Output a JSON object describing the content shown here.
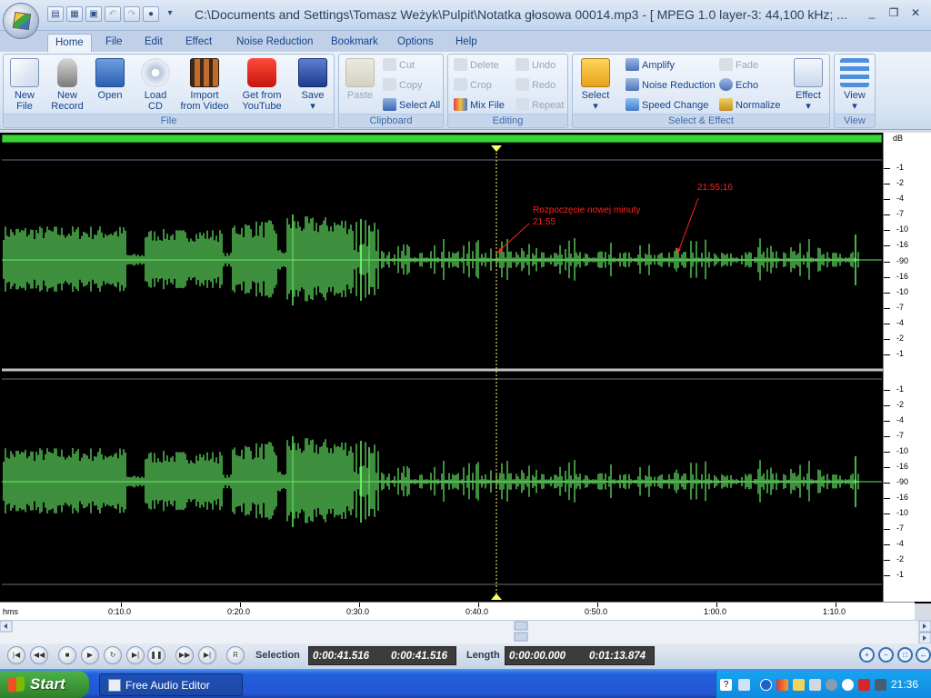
{
  "window": {
    "title": "C:\\Documents and Settings\\Tomasz Weżyk\\Pulpit\\Notatka głosowa 00014.mp3 - [ MPEG 1.0 layer-3: 44,100 kHz; ...",
    "controls": [
      "_",
      "❐",
      "✕"
    ]
  },
  "quick_access": [
    "new-file-icon",
    "open-icon",
    "save-icon",
    "undo-icon",
    "redo-icon",
    "record-icon"
  ],
  "tabs": [
    "Home",
    "File",
    "Edit",
    "Effect",
    "Noise Reduction",
    "Bookmark",
    "Options",
    "Help"
  ],
  "active_tab": "Home",
  "ribbon": {
    "file_group": {
      "label": "File",
      "buttons": [
        {
          "line1": "New",
          "line2": "File"
        },
        {
          "line1": "New",
          "line2": "Record"
        },
        {
          "line1": "Open",
          "line2": ""
        },
        {
          "line1": "Load",
          "line2": "CD"
        },
        {
          "line1": "Import",
          "line2": "from Video"
        },
        {
          "line1": "Get from",
          "line2": "YouTube"
        },
        {
          "line1": "Save",
          "line2": "▾"
        }
      ]
    },
    "clipboard_group": {
      "label": "Clipboard",
      "paste": "Paste",
      "cut": "Cut",
      "copy": "Copy",
      "select_all": "Select All"
    },
    "editing_group": {
      "label": "Editing",
      "delete": "Delete",
      "crop": "Crop",
      "mix_file": "Mix File",
      "undo": "Undo",
      "redo": "Redo",
      "repeat": "Repeat"
    },
    "select_effect_group": {
      "label": "Select & Effect",
      "select": "Select",
      "amplify": "Amplify",
      "noise_reduction": "Noise Reduction",
      "speed_change": "Speed Change",
      "fade": "Fade",
      "echo": "Echo",
      "normalize": "Normalize",
      "effect": "Effect"
    },
    "view_group": {
      "label": "View",
      "view": "View"
    }
  },
  "db_ruler": {
    "header": "dB",
    "ticks_top": [
      "-1",
      "-2",
      "-4",
      "-7",
      "-10",
      "-16",
      "-90",
      "-16",
      "-10",
      "-7",
      "-4",
      "-2",
      "-1"
    ],
    "ticks_bottom": [
      "-1",
      "-2",
      "-4",
      "-7",
      "-10",
      "-16",
      "-90",
      "-16",
      "-10",
      "-7",
      "-4",
      "-2",
      "-1"
    ]
  },
  "annotations": {
    "minute_start_label": "Rozpoczęcie nowej minuty",
    "minute_start_time": "21:55",
    "second_marker": "21:55;16"
  },
  "time_axis": {
    "unit": "hms",
    "labels": [
      "0:10.0",
      "0:20.0",
      "0:30.0",
      "0:40.0",
      "0:50.0",
      "1:00.0",
      "1:10.0"
    ]
  },
  "transport": {
    "buttons": [
      "skip-back",
      "rewind",
      "stop",
      "play",
      "loop",
      "play-selection",
      "pause",
      "fast-forward",
      "skip-forward",
      "record"
    ],
    "record_glyph": "R",
    "selection_label": "Selection",
    "selection_start": "0:00:41.516",
    "selection_end": "0:00:41.516",
    "length_label": "Length",
    "length_start": "0:00:00.000",
    "length_total": "0:01:13.874"
  },
  "taskbar": {
    "start_label": "Start",
    "task_label": "Free Audio Editor",
    "clock": "21:36"
  },
  "colors": {
    "waveform": "#66ee66",
    "annotation": "#ff2020",
    "cursor": "#ffff66"
  }
}
